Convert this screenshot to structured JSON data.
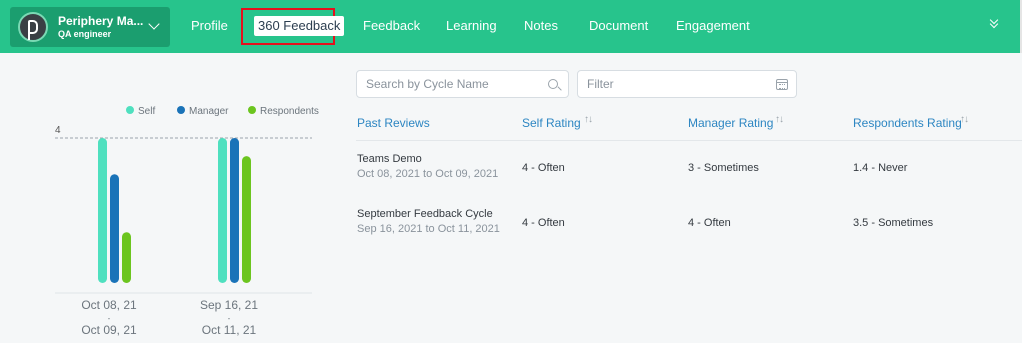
{
  "nav": {
    "user_name": "Periphery Ma...",
    "user_role": "QA engineer",
    "tabs": [
      "Profile",
      "360 Feedback",
      "Feedback",
      "Learning",
      "Notes",
      "Document",
      "Engagement"
    ],
    "active_tab": "360 Feedback",
    "colors": {
      "bar": "#27c48c",
      "chip": "#1b9e6f",
      "highlight": "#e5101d"
    }
  },
  "search": {
    "placeholder": "Search by Cycle Name"
  },
  "filter": {
    "placeholder": "Filter"
  },
  "table": {
    "headers": [
      "Past Reviews",
      "Self Rating",
      "Manager Rating",
      "Respondents Rating"
    ],
    "rows": [
      {
        "title": "Teams Demo",
        "dates": "Oct 08, 2021 to Oct 09, 2021",
        "self": "4 - Often",
        "manager": "3 - Sometimes",
        "respondents": "1.4 - Never"
      },
      {
        "title": "September Feedback Cycle",
        "dates": "Sep 16, 2021 to Oct 11, 2021",
        "self": "4 - Often",
        "manager": "4 - Often",
        "respondents": "3.5 - Sometimes"
      }
    ]
  },
  "chart_data": {
    "type": "bar",
    "categories": [
      {
        "start": "Oct 08, 21",
        "sep": "-",
        "end": "Oct 09, 21"
      },
      {
        "start": "Sep 16, 21",
        "sep": "-",
        "end": "Oct 11, 21"
      }
    ],
    "series": [
      {
        "name": "Self",
        "color": "#4fe0bf",
        "values": [
          4,
          4
        ]
      },
      {
        "name": "Manager",
        "color": "#1a73b8",
        "values": [
          3,
          4
        ]
      },
      {
        "name": "Respondents",
        "color": "#6cc51f",
        "values": [
          1.4,
          3.5
        ]
      }
    ],
    "reference_line": {
      "value": 4,
      "label": "4"
    },
    "ylim": [
      0,
      4
    ],
    "legend_position": "top-right"
  }
}
